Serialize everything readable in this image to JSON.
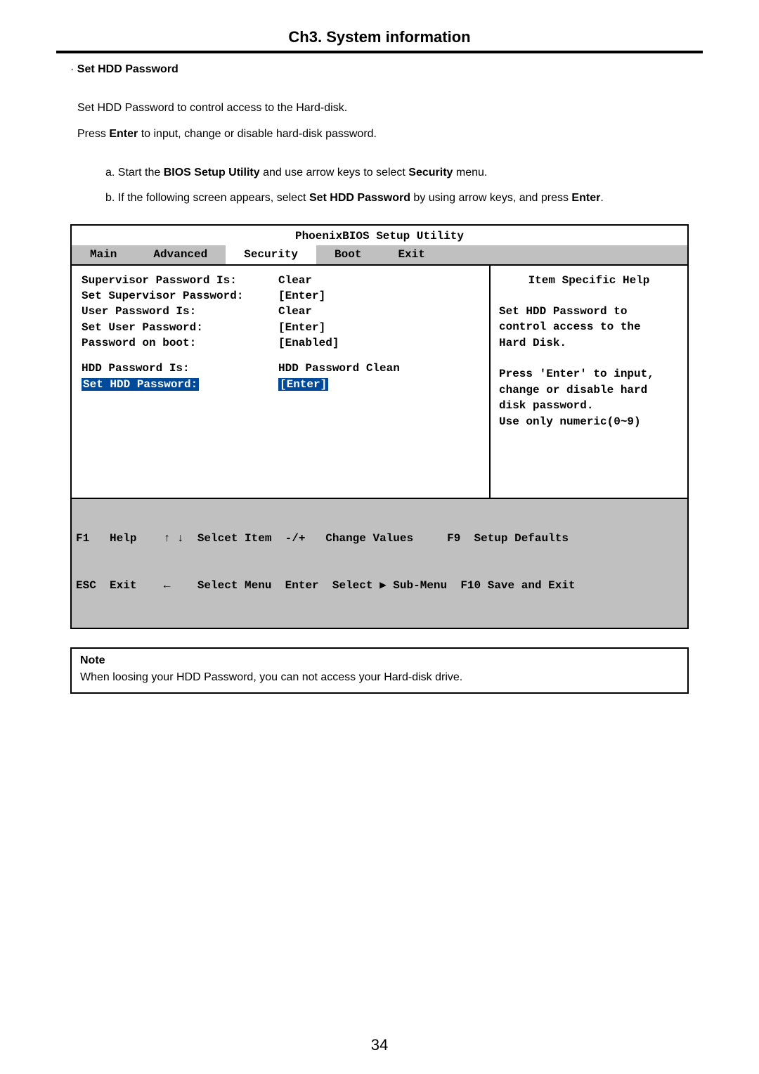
{
  "chapter_title": "Ch3. System information",
  "section_heading_prefix": "· ",
  "section_heading": "Set HDD Password",
  "body_line1_a": "Set HDD Password to control access to the Hard-disk.",
  "body_line2_a": "Press ",
  "body_line2_b": "Enter",
  "body_line2_c": " to input, change or disable hard-disk password.",
  "step_a_1": "a. Start the ",
  "step_a_2": "BIOS Setup Utility",
  "step_a_3": " and use arrow keys to select ",
  "step_a_4": "Security",
  "step_a_5": " menu.",
  "step_b_1": "b. If the following screen appears, select ",
  "step_b_2": "Set HDD Password",
  "step_b_3": " by using arrow keys, and press ",
  "step_b_4": "Enter",
  "step_b_5": ".",
  "bios": {
    "title": "PhoenixBIOS Setup Utility",
    "tabs": {
      "main": "Main",
      "advanced": "Advanced",
      "security": "Security",
      "boot": "Boot",
      "exit": "Exit"
    },
    "rows": {
      "r1_label": "Supervisor Password Is:",
      "r1_value": "Clear",
      "r2_label": "Set Supervisor Password:",
      "r2_value": "[Enter]",
      "r3_label": "User Password Is:",
      "r3_value": "Clear",
      "r4_label": "Set User Password:",
      "r4_value": "[Enter]",
      "r5_label": "Password on boot:",
      "r5_value": "[Enabled]",
      "r6_label": "HDD Password Is:",
      "r6_value": "HDD Password Clean",
      "r7_label": "Set HDD Password:",
      "r7_value": "[Enter]"
    },
    "help_title": "Item Specific Help",
    "help_text": "Set HDD Password to\ncontrol access to the\nHard Disk.\n\nPress 'Enter' to input,\nchange or disable hard\ndisk password.\nUse only numeric(0~9)",
    "footer_line1": "F1   Help    ↑ ↓  Selcet Item  -/+   Change Values     F9  Setup Defaults",
    "footer_line2": "ESC  Exit    ←    Select Menu  Enter  Select ▶ Sub-Menu  F10 Save and Exit"
  },
  "note_title": "Note",
  "note_text": "When loosing your HDD Password, you can not access your Hard-disk drive.",
  "page_number": "34"
}
